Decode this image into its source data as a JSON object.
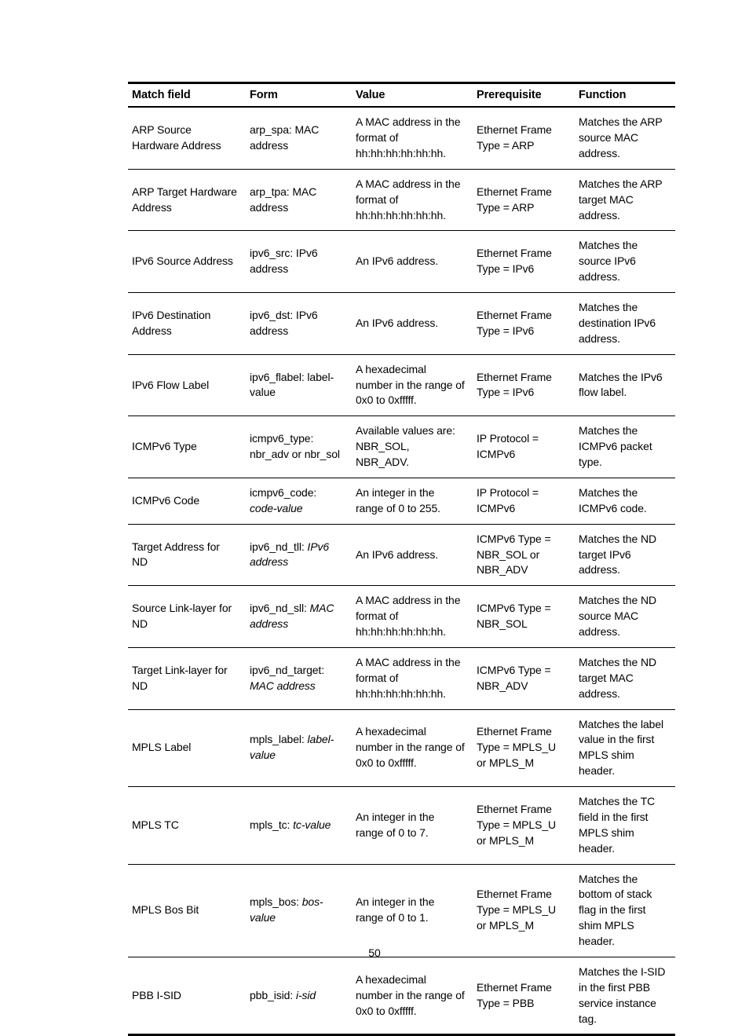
{
  "page": {
    "number": "50"
  },
  "table": {
    "name": "match-field-reference-table",
    "columns": [
      "Match field",
      "Form",
      "Value",
      "Prerequisite",
      "Function"
    ],
    "rows": [
      {
        "match_field": "ARP Source Hardware Address",
        "form_plain": "arp_spa: MAC address",
        "form_italic": "",
        "value": "A MAC address in the format of hh:hh:hh:hh:hh:hh.",
        "prerequisite": "Ethernet Frame Type = ARP",
        "function": "Matches the ARP source MAC address."
      },
      {
        "match_field": "ARP Target Hardware Address",
        "form_plain": "arp_tpa: MAC address",
        "form_italic": "",
        "value": "A MAC address in the format of hh:hh:hh:hh:hh:hh.",
        "prerequisite": "Ethernet Frame Type = ARP",
        "function": "Matches the ARP target MAC address."
      },
      {
        "match_field": "IPv6 Source Address",
        "form_plain": "ipv6_src: IPv6 address",
        "form_italic": "",
        "value": "An IPv6 address.",
        "prerequisite": "Ethernet Frame Type = IPv6",
        "function": "Matches the source IPv6 address."
      },
      {
        "match_field": "IPv6 Destination Address",
        "form_plain": "ipv6_dst: IPv6 address",
        "form_italic": "",
        "value": "An IPv6 address.",
        "prerequisite": "Ethernet Frame Type = IPv6",
        "function": "Matches the destination IPv6 address."
      },
      {
        "match_field": "IPv6 Flow Label",
        "form_plain": "ipv6_flabel: label-value",
        "form_italic": "",
        "value": "A hexadecimal number in the range of 0x0 to 0xfffff.",
        "prerequisite": "Ethernet Frame Type = IPv6",
        "function": "Matches the IPv6 flow label."
      },
      {
        "match_field": "ICMPv6 Type",
        "form_plain": "icmpv6_type: nbr_adv or nbr_sol",
        "form_italic": "",
        "value": "Available values are: NBR_SOL, NBR_ADV.",
        "prerequisite": "IP Protocol = ICMPv6",
        "function": "Matches the ICMPv6 packet type."
      },
      {
        "match_field": "ICMPv6 Code",
        "form_plain": "icmpv6_code:",
        "form_italic": "code-value",
        "value": "An integer in the range of 0 to 255.",
        "prerequisite": "IP Protocol = ICMPv6",
        "function": "Matches the ICMPv6 code."
      },
      {
        "match_field": "Target Address for ND",
        "form_plain": "ipv6_nd_tll: ",
        "form_italic": "IPv6 address",
        "value": "An IPv6 address.",
        "prerequisite": "ICMPv6 Type = NBR_SOL or NBR_ADV",
        "function": "Matches the ND target IPv6 address."
      },
      {
        "match_field": "Source Link-layer for ND",
        "form_plain": "ipv6_nd_sll: ",
        "form_italic": "MAC address",
        "value": "A MAC address in the format of hh:hh:hh:hh:hh:hh.",
        "prerequisite": "ICMPv6 Type = NBR_SOL",
        "function": "Matches the ND source MAC address."
      },
      {
        "match_field": "Target Link-layer for ND",
        "form_plain": "ipv6_nd_target:",
        "form_italic": "MAC address",
        "value": "A MAC address in the format of hh:hh:hh:hh:hh:hh.",
        "prerequisite": "ICMPv6 Type = NBR_ADV",
        "function": "Matches the ND target MAC address."
      },
      {
        "match_field": "MPLS Label",
        "form_plain": "mpls_label:",
        "form_italic": "label-value",
        "value": "A hexadecimal number in the range of 0x0 to 0xfffff.",
        "prerequisite": "Ethernet Frame Type = MPLS_U or MPLS_M",
        "function": "Matches the label value in the first MPLS shim header."
      },
      {
        "match_field": "MPLS TC",
        "form_plain": "mpls_tc: ",
        "form_italic": "tc-value",
        "value": "An integer in the range of 0 to 7.",
        "prerequisite": "Ethernet Frame Type = MPLS_U or MPLS_M",
        "function": "Matches the TC field in the first MPLS shim header."
      },
      {
        "match_field": "MPLS Bos Bit",
        "form_plain": "mpls_bos:",
        "form_italic": "bos-value",
        "value": "An integer in the range of 0 to 1.",
        "prerequisite": "Ethernet Frame Type = MPLS_U or MPLS_M",
        "function": "Matches the bottom of stack flag in the first shim MPLS header."
      },
      {
        "match_field": "PBB I-SID",
        "form_plain": "pbb_isid: ",
        "form_italic": "i-sid",
        "value": "A hexadecimal number in the range of 0x0 to 0xfffff.",
        "prerequisite": "Ethernet Frame Type = PBB",
        "function": "Matches the I-SID in the first PBB service instance tag."
      }
    ]
  }
}
